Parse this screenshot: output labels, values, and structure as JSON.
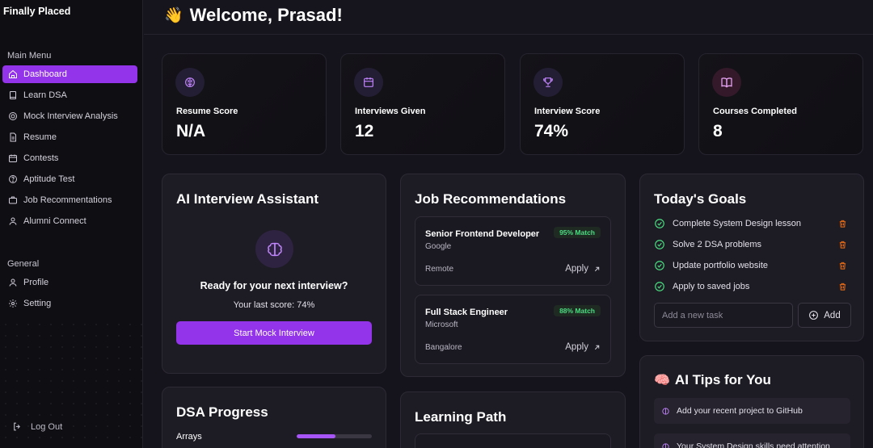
{
  "app": {
    "brand": "Finally Placed"
  },
  "sidebar": {
    "main_label": "Main Menu",
    "main_items": [
      {
        "label": "Dashboard",
        "icon": "home-icon",
        "active": true
      },
      {
        "label": "Learn DSA",
        "icon": "book-icon"
      },
      {
        "label": "Mock Interview Analysis",
        "icon": "target-icon"
      },
      {
        "label": "Resume",
        "icon": "file-icon"
      },
      {
        "label": "Contests",
        "icon": "calendar-icon"
      },
      {
        "label": "Aptitude Test",
        "icon": "help-circle-icon"
      },
      {
        "label": "Job Recommentations",
        "icon": "briefcase-icon"
      },
      {
        "label": "Alumni Connect",
        "icon": "user-icon"
      }
    ],
    "general_label": "General",
    "general_items": [
      {
        "label": "Profile",
        "icon": "user-icon"
      },
      {
        "label": "Setting",
        "icon": "gear-icon"
      }
    ],
    "logout_label": "Log Out"
  },
  "header": {
    "wave": "👋",
    "welcome": "Welcome, Prasad!"
  },
  "stats": [
    {
      "label": "Resume Score",
      "value": "N/A",
      "icon": "brain-icon"
    },
    {
      "label": "Interviews Given",
      "value": "12",
      "icon": "calendar-icon"
    },
    {
      "label": "Interview Score",
      "value": "74%",
      "icon": "trophy-icon"
    },
    {
      "label": "Courses Completed",
      "value": "8",
      "icon": "open-book-icon"
    }
  ],
  "ai_assistant": {
    "title": "AI Interview Assistant",
    "ready_text": "Ready for your next interview?",
    "last_score": "Your last score: 74%",
    "button": "Start Mock Interview"
  },
  "jobs": {
    "title": "Job Recommendations",
    "items": [
      {
        "title": "Senior Frontend Developer",
        "company": "Google",
        "location": "Remote",
        "match": "95% Match",
        "apply": "Apply"
      },
      {
        "title": "Full Stack Engineer",
        "company": "Microsoft",
        "location": "Bangalore",
        "match": "88% Match",
        "apply": "Apply"
      }
    ]
  },
  "goals": {
    "title": "Today's Goals",
    "items": [
      "Complete System Design lesson",
      "Solve 2 DSA problems",
      "Update portfolio website",
      "Apply to saved jobs"
    ],
    "input_placeholder": "Add a new task",
    "add_label": "Add"
  },
  "tips": {
    "emoji": "🧠",
    "title": "AI Tips for You",
    "items": [
      "Add your recent project to GitHub",
      "Your System Design skills need attention"
    ]
  },
  "dsa": {
    "title": "DSA Progress",
    "items": [
      {
        "label": "Arrays",
        "progress": 0.52
      }
    ]
  },
  "learning": {
    "title": "Learning Path"
  },
  "colors": {
    "accent": "#9333ea",
    "match_green": "#4ade80",
    "trash": "#f97316",
    "check": "#4ade80"
  }
}
